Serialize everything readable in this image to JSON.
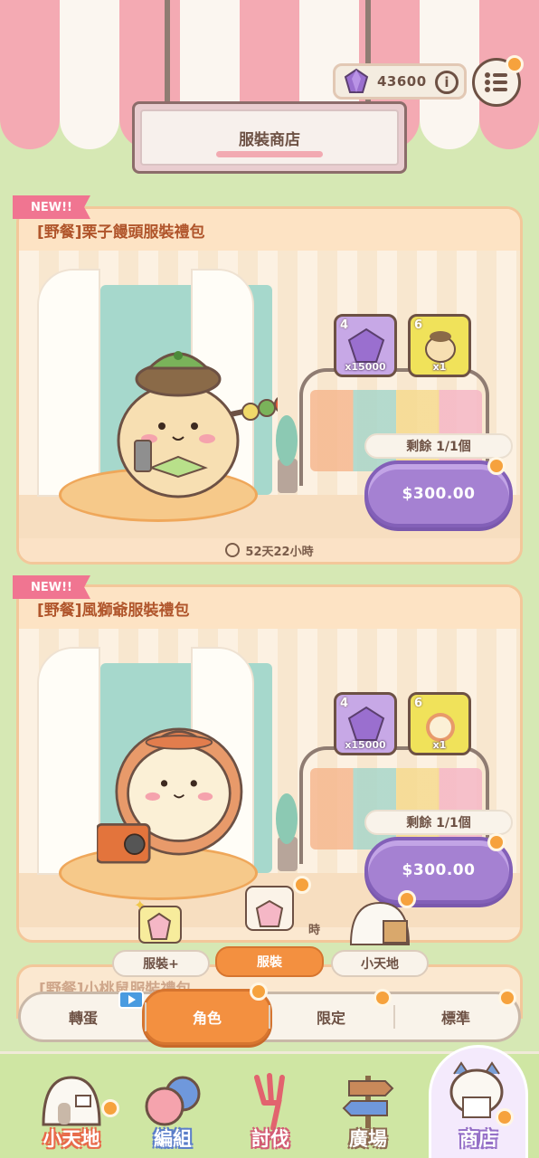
{
  "header": {
    "currency_amount": "43600",
    "info_label": "i",
    "shop_title": "服裝商店"
  },
  "offers": [
    {
      "tag": "NEW!!",
      "title": "[野餐]栗子饅頭服裝禮包",
      "items": [
        {
          "star": "4",
          "qty": "x15000",
          "icon": "gem-icon"
        },
        {
          "star": "6",
          "qty": "x1",
          "icon": "character-costume-icon"
        }
      ],
      "remaining": "剩餘 1/1個",
      "price": "$300.00",
      "timer": "52天22小時"
    },
    {
      "tag": "NEW!!",
      "title": "[野餐]風獅爺服裝禮包",
      "items": [
        {
          "star": "4",
          "qty": "x15000",
          "icon": "gem-icon"
        },
        {
          "star": "6",
          "qty": "x1",
          "icon": "character-costume-icon"
        }
      ],
      "remaining": "剩餘 1/1個",
      "price": "$300.00",
      "timer": "時"
    }
  ],
  "peek_card_title": "[野餐]小桃鼠服裝禮包",
  "sub_tabs": [
    {
      "label": "服裝+",
      "active": false
    },
    {
      "label": "服裝",
      "active": true
    },
    {
      "label": "小天地",
      "active": false
    }
  ],
  "main_tabs": [
    {
      "label": "轉蛋",
      "active": false
    },
    {
      "label": "角色",
      "active": true
    },
    {
      "label": "限定",
      "active": false
    },
    {
      "label": "標準",
      "active": false
    }
  ],
  "bottom_nav": [
    {
      "label": "小天地",
      "icon": "house-icon"
    },
    {
      "label": "編組",
      "icon": "team-icon"
    },
    {
      "label": "討伐",
      "icon": "fork-icon"
    },
    {
      "label": "廣場",
      "icon": "signpost-icon"
    },
    {
      "label": "商店",
      "icon": "shop-cat-icon",
      "active": true
    }
  ],
  "colors": {
    "accent_orange": "#f39040",
    "price_purple": "#a581d2",
    "title_brown": "#b0552b",
    "new_tag_pink": "#f07591"
  }
}
